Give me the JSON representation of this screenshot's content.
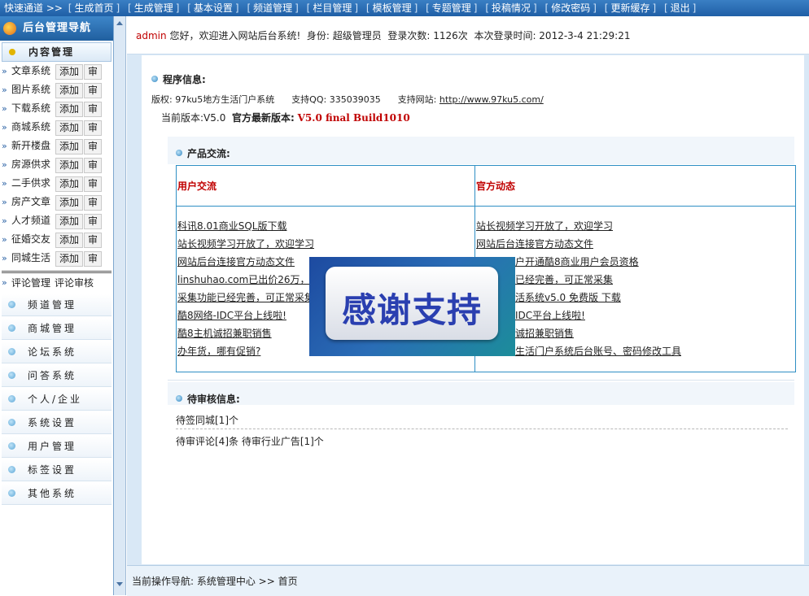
{
  "topbar": {
    "quick": "快速通道",
    "arrows": ">>",
    "links": [
      "生成首页",
      "生成管理",
      "基本设置",
      "频道管理",
      "栏目管理",
      "模板管理",
      "专题管理",
      "投稿情况",
      "修改密码",
      "更新缓存",
      "退出"
    ]
  },
  "sidebar": {
    "title": "后台管理导航",
    "section": "内容管理",
    "add_label": "添加",
    "review_label": "审",
    "items": [
      "文章系统",
      "图片系统",
      "下载系统",
      "商城系统",
      "新开楼盘",
      "房源供求",
      "二手供求",
      "房产文章",
      "人才频道",
      "征婚交友",
      "同城生活"
    ],
    "comment": "评论管理",
    "comment_review": "评论审核",
    "groups": [
      "频道管理",
      "商城管理",
      "论坛系统",
      "问答系统",
      "个人/企业",
      "系统设置",
      "用户管理",
      "标签设置",
      "其他系统"
    ]
  },
  "welcome": {
    "user": "admin",
    "greeting": "您好，欢迎进入网站后台系统!",
    "role": "身份: 超级管理员",
    "logins": "登录次数: 1126次",
    "time": "本次登录时间: 2012-3-4 21:29:21"
  },
  "program": {
    "title": "程序信息:",
    "copyright": "版权: 97ku5地方生活门户系统",
    "qq": "支持QQ: 335039035",
    "site_label": "支持网站:",
    "site_url": "http://www.97ku5.com/",
    "version": "当前版本:V5.0",
    "latest_label": "官方最新版本:",
    "latest": "V5.0 final Build1010"
  },
  "products": {
    "title": "产品交流:",
    "col1_title": "用户交流",
    "col2_title": "官方动态",
    "col1": [
      "科讯8.01商业SQL版下载",
      "站长视频学习开放了，欢迎学习",
      "网站后台连接官方动态文件",
      "linshuhao.com已出价26万，正",
      "采集功能已经完善，可正常采集",
      "酷8网络-IDC平台上线啦!",
      "酷8主机诚招兼职销售",
      "办年货，哪有促销?"
    ],
    "col2": [
      "站长视频学习开放了，欢迎学习",
      "网站后台连接官方动态文件",
      "户开通酷8商业用户会员资格",
      "已经完善，可正常采集",
      "活系统v5.0 免费版 下载",
      "IDC平台上线啦!",
      "诚招兼职销售",
      "生活门户系统后台账号、密码修改工具"
    ]
  },
  "pending": {
    "title": "待审核信息:",
    "line1": "待签同城[1]个",
    "line2": "待审评论[4]条 待审行业广告[1]个"
  },
  "overlay": {
    "text": "感谢支持"
  },
  "footer": {
    "text": "当前操作导航: 系统管理中心 >> 首页"
  }
}
